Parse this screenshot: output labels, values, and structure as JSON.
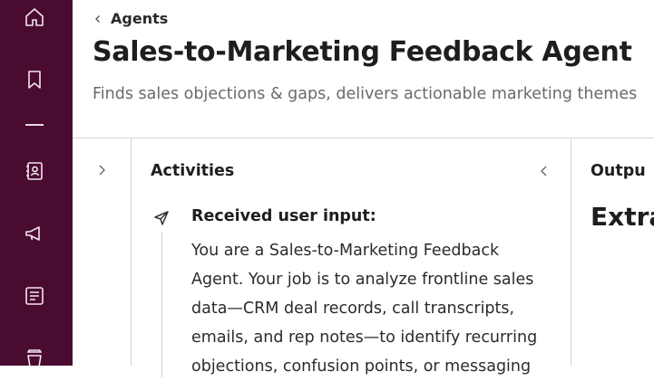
{
  "sidebar": {
    "items": [
      {
        "icon": "home-icon"
      },
      {
        "icon": "bookmark-icon"
      },
      {
        "icon": "contacts-icon"
      },
      {
        "icon": "megaphone-icon"
      },
      {
        "icon": "news-icon"
      },
      {
        "icon": "cup-icon"
      }
    ],
    "background": "#4a0b30"
  },
  "header": {
    "breadcrumb": "Agents",
    "title": "Sales-to-Marketing Feedback Agent",
    "subtitle": "Finds sales objections & gaps, delivers actionable marketing themes"
  },
  "activities": {
    "title": "Activities",
    "items": [
      {
        "heading": "Received user input:",
        "body": "You are a Sales-to-Marketing Feedback Agent. Your job is to analyze frontline sales data—CRM deal records, call transcripts, emails, and rep notes—to identify recurring objections, confusion points, or messaging"
      }
    ]
  },
  "output": {
    "title": "Outpu",
    "heading": "Extra"
  }
}
